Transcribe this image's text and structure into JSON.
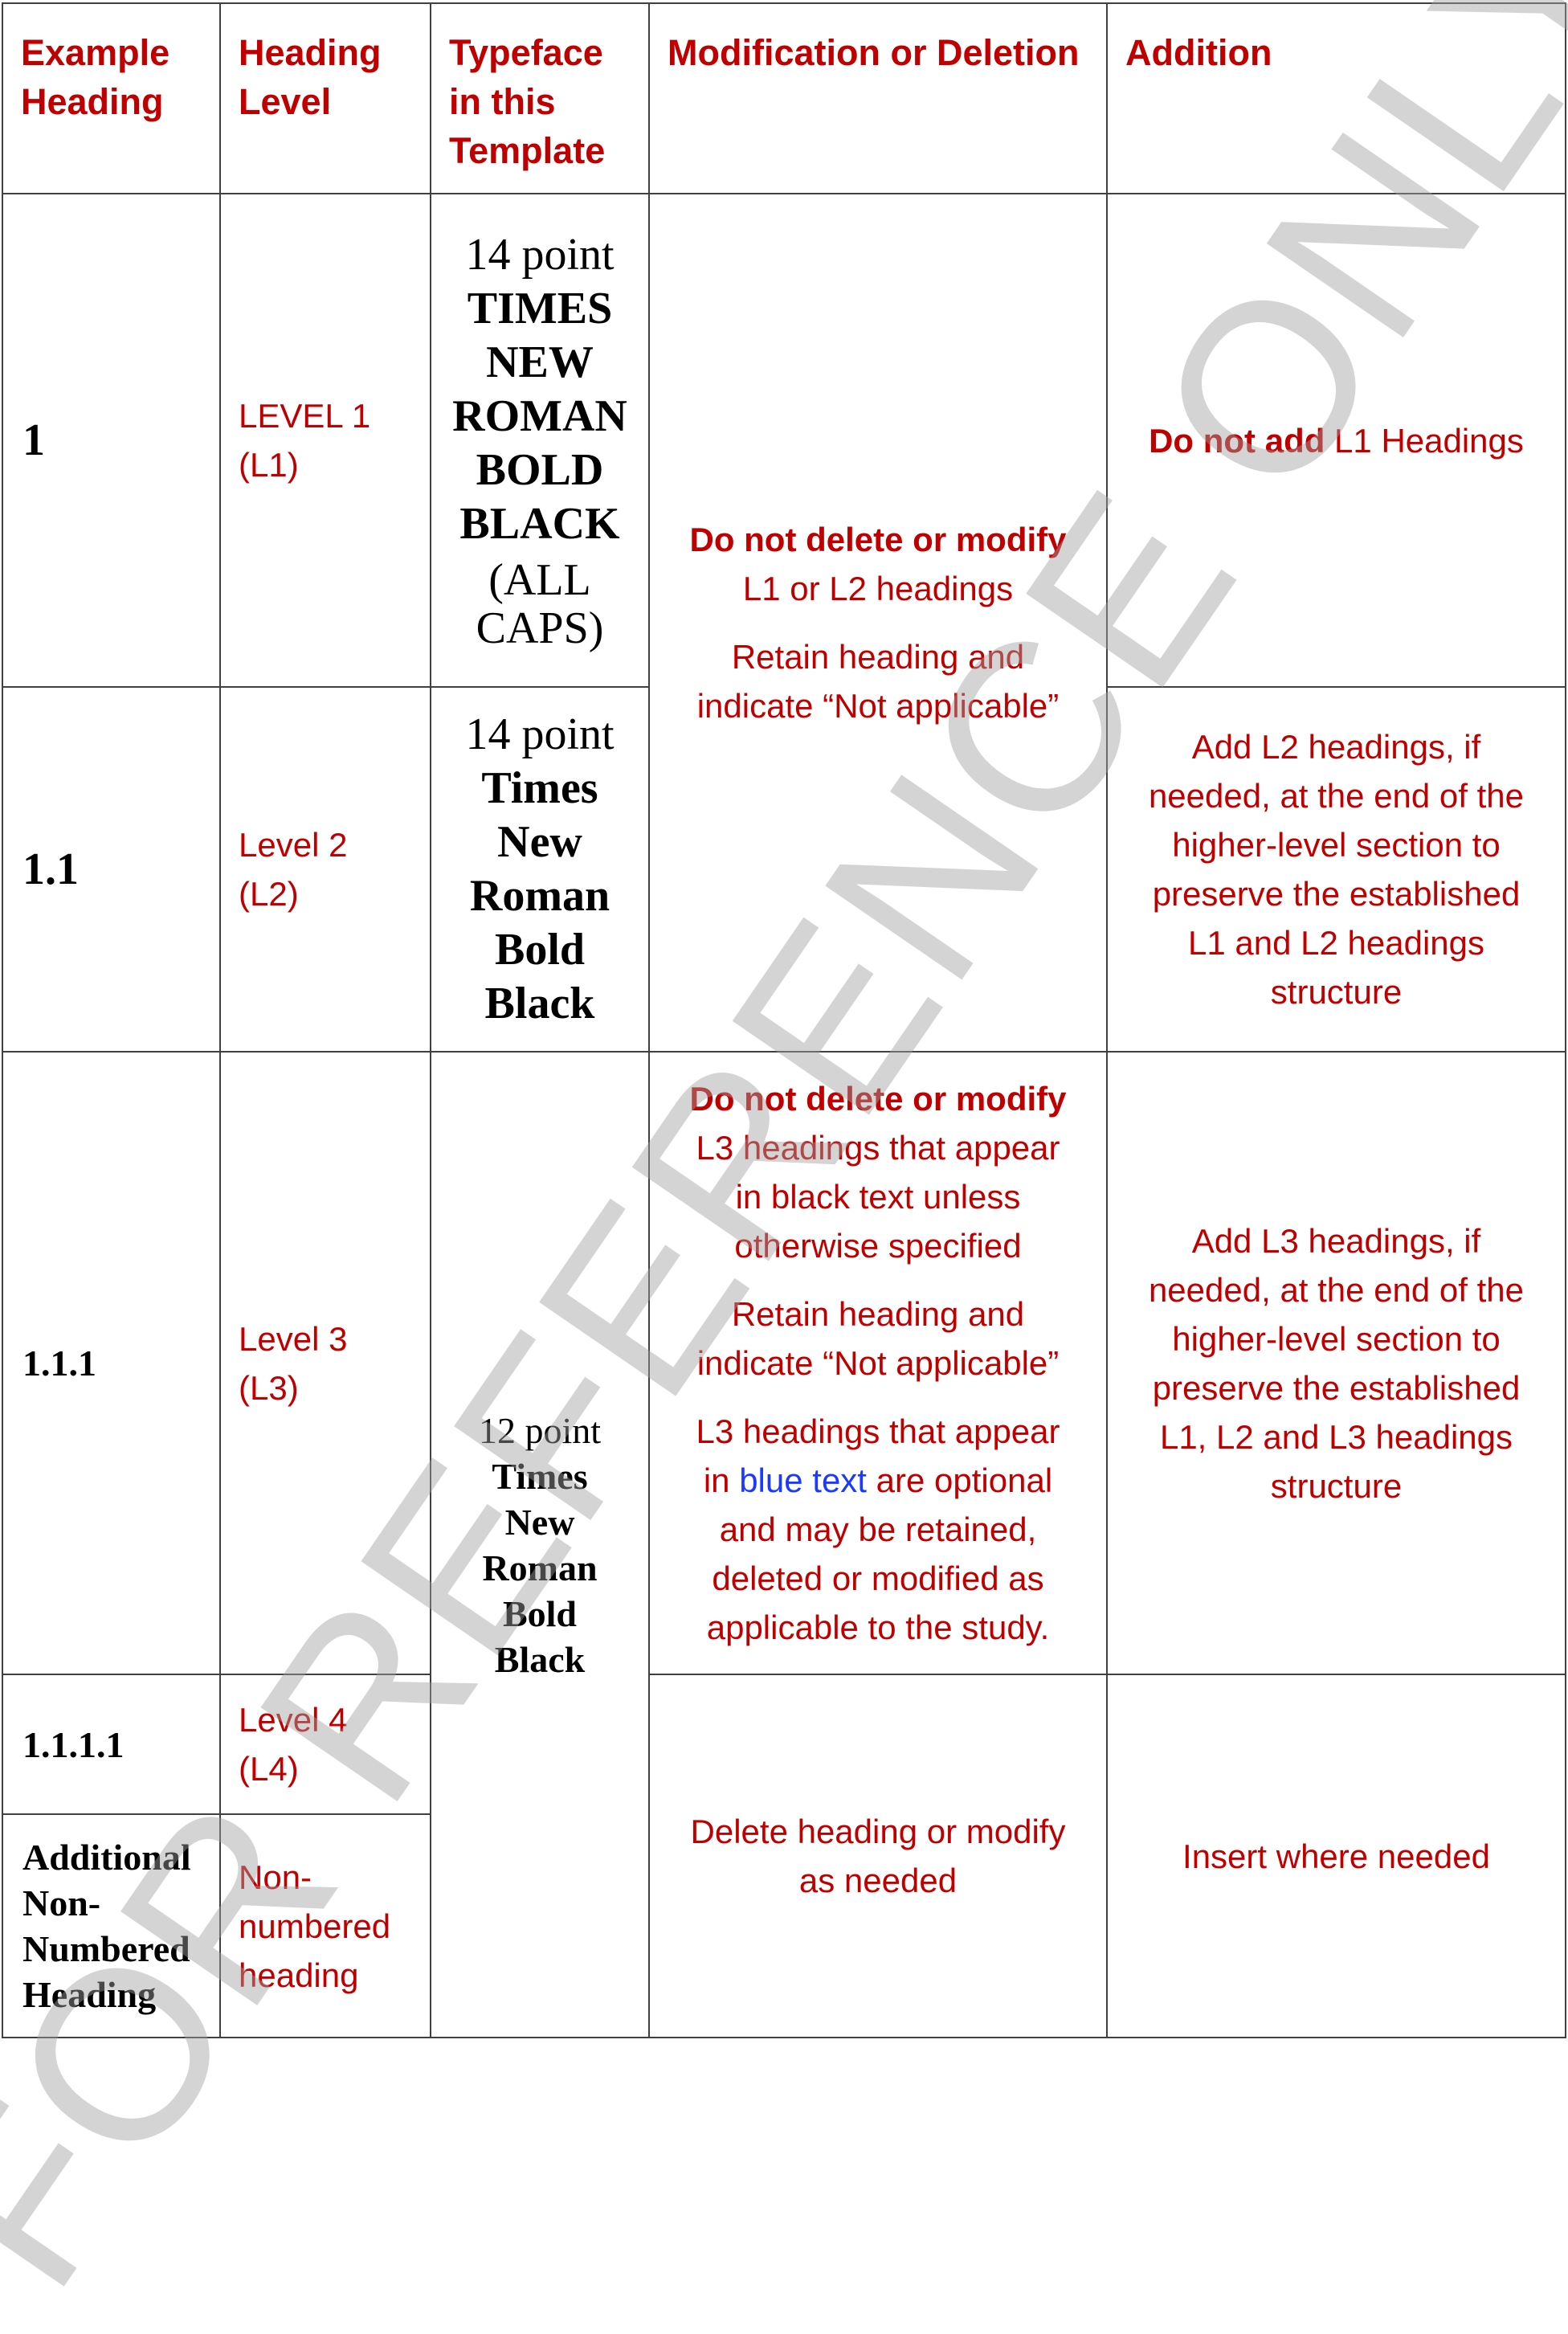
{
  "headers": {
    "example_heading": [
      "Example",
      "Heading"
    ],
    "heading_level": [
      "Heading",
      "Level"
    ],
    "typeface": [
      "Typeface",
      "in this",
      "Template"
    ],
    "modification": "Modification or Deletion",
    "addition": "Addition"
  },
  "rows": {
    "l1": {
      "example": "1",
      "level": [
        "LEVEL 1",
        "(L1)"
      ],
      "typeface_size": "14 point",
      "typeface_style": [
        "TIMES",
        "NEW",
        "ROMAN",
        "BOLD",
        "BLACK"
      ],
      "typeface_caps": [
        "(ALL",
        "CAPS)"
      ],
      "addition_bold": "Do not add",
      "addition_rest": " L1 Headings"
    },
    "l2": {
      "example": "1.1",
      "level": [
        "Level 2",
        "(L2)"
      ],
      "typeface_size": "14 point",
      "typeface_style": [
        "Times",
        "New",
        "Roman",
        "Bold",
        "Black"
      ],
      "addition": [
        "Add L2 headings, if",
        "needed, at the end of the",
        "higher-level section to",
        "preserve the established",
        "L1 and L2 headings",
        "structure"
      ]
    },
    "l12_mod": {
      "bold": "Do not delete or modify",
      "line2": "L1 or L2 headings",
      "retain": [
        "Retain heading and",
        "indicate “Not applicable”"
      ]
    },
    "l3": {
      "example": "1.1.1",
      "level": [
        "Level 3",
        "(L3)"
      ],
      "mod_bold": "Do not delete or modify",
      "mod_lines": [
        "L3 headings that appear",
        "in black text unless",
        "otherwise specified"
      ],
      "retain": [
        "Retain heading and",
        "indicate “Not applicable”"
      ],
      "optional_line1": "L3 headings that appear",
      "optional_in": "in ",
      "optional_blue": "blue text",
      "optional_after": " are optional",
      "optional_rest": [
        "and may be retained,",
        "deleted or modified as",
        "applicable to the study."
      ],
      "addition": [
        "Add L3 headings, if",
        "needed, at the end of the",
        "higher-level section to",
        "preserve the established",
        "L1, L2 and L3 headings",
        "structure"
      ]
    },
    "l3_typeface": {
      "size": "12 point",
      "style": [
        "Times",
        "New",
        "Roman",
        "Bold",
        "Black"
      ]
    },
    "l4": {
      "example": "1.1.1.1",
      "level": [
        "Level 4",
        "(L4)"
      ]
    },
    "nn": {
      "example": [
        "Additional",
        "Non-",
        "Numbered",
        "Heading"
      ],
      "level": [
        "Non-",
        "numbered",
        "heading"
      ]
    },
    "l4nn_mod": [
      "Delete heading or modify",
      "as needed"
    ],
    "l4nn_add": "Insert where needed"
  },
  "watermark": "FOR REFERENCE ONLY",
  "colors": {
    "red": "#c00000",
    "blue": "#1a3bff",
    "watermark": "#a0a0a0"
  }
}
